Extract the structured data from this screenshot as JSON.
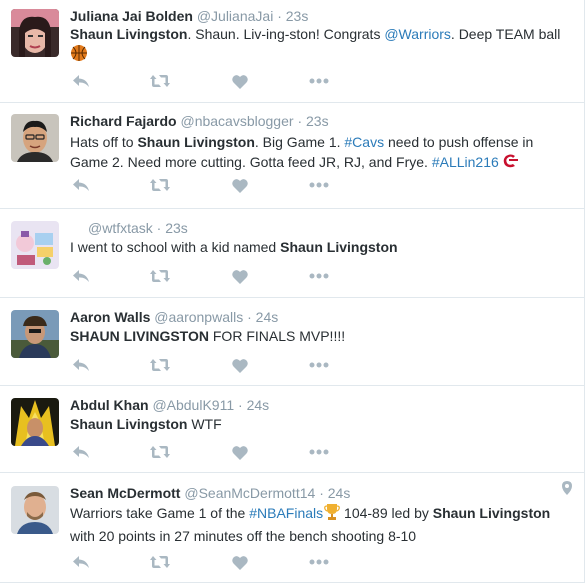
{
  "tweets": [
    {
      "fullname": "Juliana Jai Bolden",
      "handle": "@JulianaJai",
      "time": "23s",
      "text": [
        {
          "t": "Shaun Livingston",
          "b": true
        },
        {
          "t": ". Shaun. Liv-ing-ston! Congrats "
        },
        {
          "t": "@Warriors",
          "link": true
        },
        {
          "t": ". Deep TEAM ball"
        }
      ],
      "emoji": "basketball-icon"
    },
    {
      "fullname": "Richard Fajardo",
      "handle": "@nbacavsblogger",
      "time": "23s",
      "text": [
        {
          "t": "Hats off to "
        },
        {
          "t": "Shaun Livingston",
          "b": true
        },
        {
          "t": ". Big Game 1. "
        },
        {
          "t": "#Cavs",
          "link": true
        },
        {
          "t": " need to push offense in Game 2. Need more cutting. Gotta feed JR, RJ, and Frye. "
        },
        {
          "t": "#ALLin216",
          "link": true
        }
      ],
      "emoji": "cavs-logo-icon"
    },
    {
      "fullname": "",
      "handle": "@wtfxtask",
      "time": "23s",
      "text": [
        {
          "t": "I went to school with a kid named "
        },
        {
          "t": "Shaun Livingston",
          "b": true
        }
      ]
    },
    {
      "fullname": "Aaron Walls",
      "handle": "@aaronpwalls",
      "time": "24s",
      "text": [
        {
          "t": "SHAUN LIVINGSTON",
          "b": true
        },
        {
          "t": " FOR FINALS MVP!!!!"
        }
      ]
    },
    {
      "fullname": "Abdul Khan",
      "handle": "@AbdulK911",
      "time": "24s",
      "text": [
        {
          "t": "Shaun Livingston",
          "b": true
        },
        {
          "t": " WTF"
        }
      ]
    },
    {
      "fullname": "Sean McDermott",
      "handle": "@SeanMcDermott14",
      "time": "24s",
      "text": [
        {
          "t": "Warriors take Game 1 of the "
        },
        {
          "t": "#NBAFinals",
          "link": true
        },
        {
          "t": "🏆",
          "trophy": true
        },
        {
          "t": " 104-89 led by "
        },
        {
          "t": "Shaun Livingston",
          "b": true
        },
        {
          "t": " with 20 points in  27 minutes off the bench shooting 8-10"
        }
      ],
      "geo": "location-pin-icon"
    }
  ],
  "separator": "·",
  "actions": [
    "reply-icon",
    "retweet-icon",
    "like-icon",
    "more-icon"
  ],
  "colors": {
    "link": "#2b7bb9",
    "muted": "#8899a6",
    "icon": "#aab8c2",
    "text": "#292f33"
  }
}
